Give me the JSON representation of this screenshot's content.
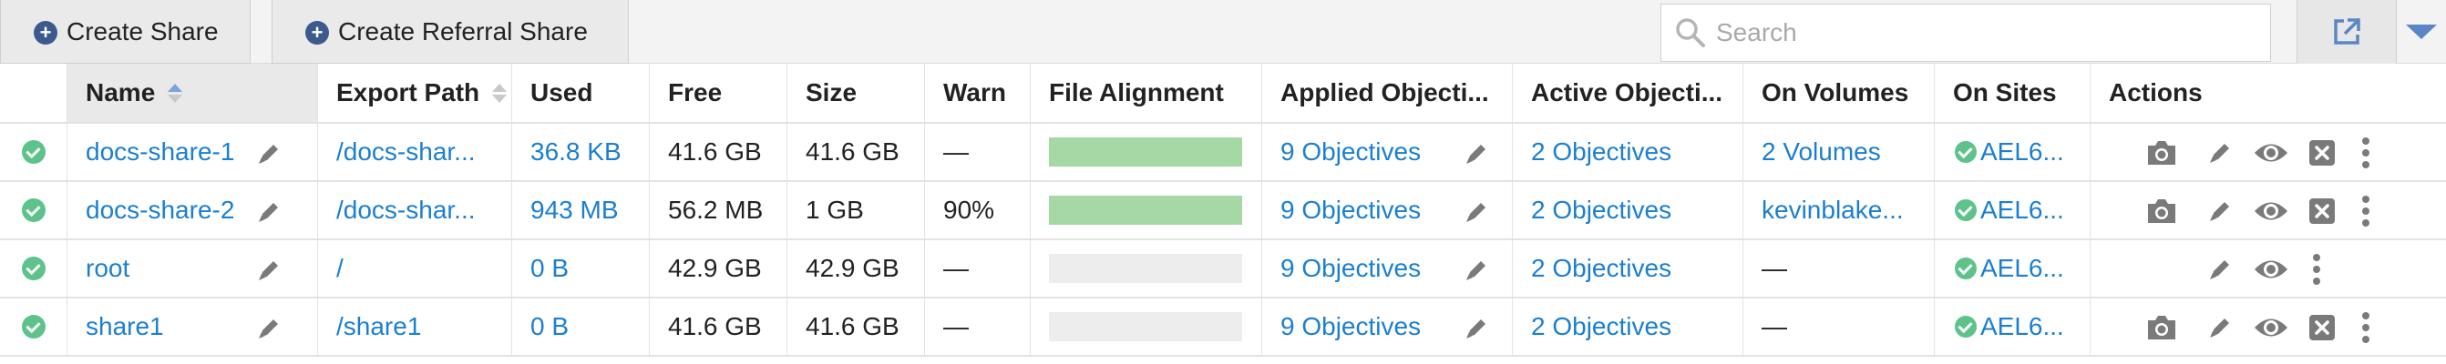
{
  "toolbar": {
    "create_share_label": "Create Share",
    "create_referral_label": "Create Referral Share",
    "search_placeholder": "Search",
    "search_value": ""
  },
  "columns": [
    "Name",
    "Export Path",
    "Used",
    "Free",
    "Size",
    "Warn",
    "File Alignment",
    "Applied Objecti...",
    "Active Objecti...",
    "On Volumes",
    "On Sites",
    "Actions"
  ],
  "colors": {
    "link": "#1b7fd1",
    "status_ok": "#5dc38a",
    "alignment_fill": "#a6d8a6",
    "icon": "#7a7a7a"
  },
  "rows": [
    {
      "name": "docs-share-1",
      "path": "/docs-shar...",
      "used": "36.8 KB",
      "free": "41.6 GB",
      "size": "41.6 GB",
      "warn": "—",
      "alignment": 1.0,
      "applied": "9 Objectives",
      "active": "2 Objectives",
      "volumes": "2 Volumes",
      "sites": "AEL6...",
      "actions": [
        "camera-icon",
        "pencil-icon",
        "eye-icon",
        "close-box-icon",
        "more-icon"
      ]
    },
    {
      "name": "docs-share-2",
      "path": "/docs-shar...",
      "used": "943 MB",
      "free": "56.2 MB",
      "size": "1 GB",
      "warn": "90%",
      "alignment": 1.0,
      "applied": "9 Objectives",
      "active": "2 Objectives",
      "volumes": "kevinblake...",
      "sites": "AEL6...",
      "actions": [
        "camera-icon",
        "pencil-icon",
        "eye-icon",
        "close-box-icon",
        "more-icon"
      ]
    },
    {
      "name": "root",
      "path": "/",
      "used": "0 B",
      "free": "42.9 GB",
      "size": "42.9 GB",
      "warn": "—",
      "alignment": 0.0,
      "applied": "9 Objectives",
      "active": "2 Objectives",
      "volumes": "—",
      "sites": "AEL6...",
      "actions": [
        "pencil-icon",
        "eye-icon",
        "more-icon"
      ]
    },
    {
      "name": "share1",
      "path": "/share1",
      "used": "0 B",
      "free": "41.6 GB",
      "size": "41.6 GB",
      "warn": "—",
      "alignment": 0.0,
      "applied": "9 Objectives",
      "active": "2 Objectives",
      "volumes": "—",
      "sites": "AEL6...",
      "actions": [
        "camera-icon",
        "pencil-icon",
        "eye-icon",
        "close-box-icon",
        "more-icon"
      ]
    }
  ]
}
